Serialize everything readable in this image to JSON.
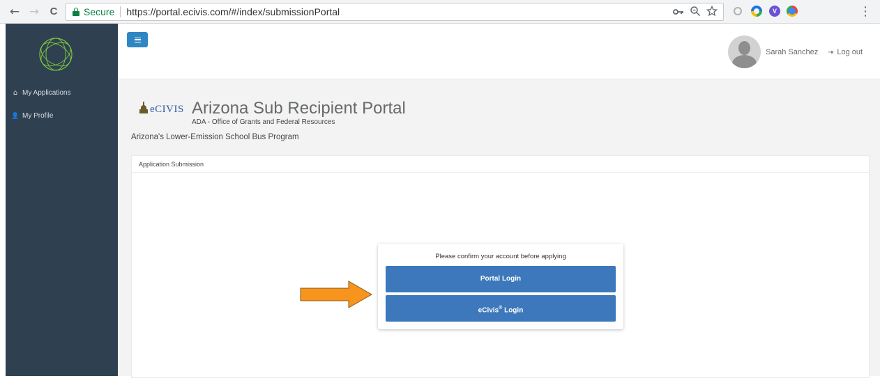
{
  "browser": {
    "secure_label": "Secure",
    "url": "https://portal.ecivis.com/#/index/submissionPortal",
    "back_glyph": "←",
    "forward_glyph": "→",
    "reload_glyph": "C",
    "menu_glyph": "⋮",
    "omni_icons": [
      "key-icon",
      "zoom-icon",
      "star-icon"
    ]
  },
  "sidebar": {
    "items": [
      {
        "label": "My Applications",
        "icon": "home-icon",
        "glyph": "⌂"
      },
      {
        "label": "My Profile",
        "icon": "user-icon",
        "glyph": "👤"
      }
    ],
    "bg": "#2f4050"
  },
  "header": {
    "user_name": "Sarah Sanchez",
    "logout_label": "Log out",
    "logout_glyph": "⇥"
  },
  "page": {
    "brand": "eCIVIS",
    "title": "Arizona Sub Recipient Portal",
    "subtitle": "ADA - Office of Grants and Federal Resources",
    "program": "Arizona's Lower-Emission School Bus Program",
    "panel_title": "Application Submission",
    "confirm_text": "Please confirm your account before applying",
    "portal_login_label": "Portal Login",
    "ecivis_login_label": "eCivis",
    "ecivis_login_suffix": " Login",
    "registered_mark": "®"
  },
  "colors": {
    "accent": "#3c78bb",
    "arrow": "#f7941d",
    "secure": "#0b8043"
  }
}
